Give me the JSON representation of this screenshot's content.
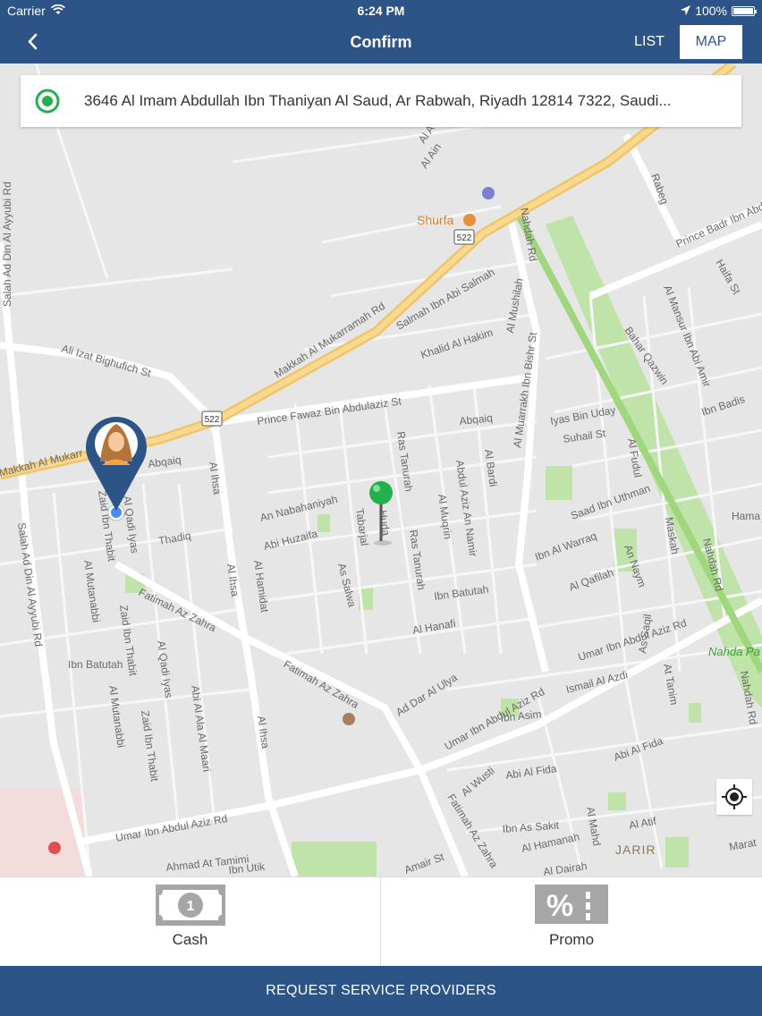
{
  "status": {
    "carrier": "Carrier",
    "time": "6:24 PM",
    "battery": "100%"
  },
  "nav": {
    "title": "Confirm",
    "tab_list": "LIST",
    "tab_map": "MAP"
  },
  "address": {
    "text": "3646 Al Imam Abdullah Ibn Thaniyan Al Saud,  Ar Rabwah,  Riyadh 12814 7322,  Saudi..."
  },
  "map": {
    "road_shields": [
      "522",
      "522"
    ],
    "pois": [
      "Shurfa",
      "JARIR",
      "Nahda Pa"
    ],
    "streets": [
      "Makkah Al Mukarramah Rd",
      "Makkah Al Mukarr",
      "Prince Fawaz Bin Abdulaziz St",
      "Ali Izat Bighufich St",
      "Salmah Ibn Abi Salmah",
      "Khalid Al Hakim",
      "Al Mushilah",
      "Nahdah Rd",
      "Rabeg",
      "Prince Badr Ibn Abd",
      "Al Mansur Ibn Abi Amir",
      "Bahar Qazwin",
      "Ibn Badis",
      "Iyas Bin Uday",
      "Suhail St",
      "Abqaiq",
      "Abqaiq",
      "Ras Tanurah",
      "Ras Tanurah",
      "Abdul Aziz An Namir",
      "Al Bardi",
      "Al Muarrakh Ibn Bishr St",
      "Al Ihsa",
      "Al Ihsa",
      "Al Ihsa",
      "An Nabahaniyah",
      "Abi Huzaifa",
      "Tabarjal",
      "As Salwa",
      "Al Muqrin",
      "Ibn Batutah",
      "Al Hanafi",
      "Thadiq",
      "Al Qadi Iyas",
      "Zaid Ibn Thabit",
      "Zaid Ibn Thabit",
      "Al Mutanabbi",
      "Al Mutanabbi",
      "Ibn Batutah",
      "Fatimah Az Zahra",
      "Fatimah Az Zahra",
      "Al Hamidat",
      "Abi Al Ala Al Maari",
      "Al Qadi Iyas",
      "Zaid Ibn Thabit",
      "Salah Ad Din Al Ayyubi Rd",
      "Salah Ad Din Al Ayyubi Rd",
      "Ad Dar Al Ulya",
      "Umar Ibn Abdul Aziz Rd",
      "Umar Ibn Abdul Aziz Rd",
      "Umar Ibn Abdul Aziz Rd",
      "Ibn Asim",
      "Ismail Al Azdi",
      "As Saqil",
      "At Tanim",
      "Abi Al Fida",
      "Abi Al Fida",
      "Al Wusti",
      "Ibn As Sakit",
      "Al Hamanah",
      "Al Mahd",
      "Al Atif",
      "Al Dairah",
      "Fatimah Az Zahra",
      "Ahmad At Tamimi",
      "Saad Ibn Uthman",
      "Ibn Al Warraq",
      "Al Qafilah",
      "An Naym",
      "Al Fudul",
      "Maskah",
      "Nahdah Rd",
      "Nahdah Rd",
      "Haifa St",
      "Hama",
      "Marat",
      "Ibn Utik",
      "Amair St",
      "Huda",
      "Al Ain",
      "Al Awsa"
    ]
  },
  "payment": {
    "cash_label": "Cash",
    "cash_number": "1",
    "promo_label": "Promo",
    "promo_symbol": "%"
  },
  "request": {
    "label": "REQUEST SERVICE PROVIDERS"
  },
  "colors": {
    "header": "#2d5486",
    "road_major": "#f5d27a",
    "park": "#b7e0a0",
    "pin_green": "#22b14c"
  }
}
